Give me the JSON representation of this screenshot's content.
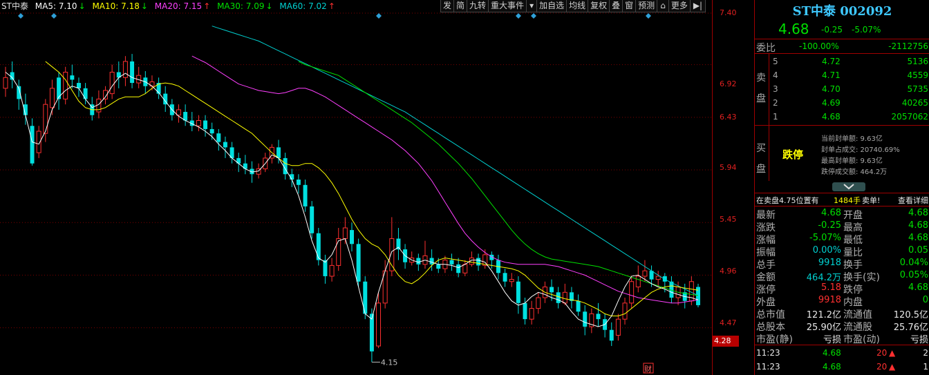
{
  "ma_legend": {
    "stock": "ST中泰",
    "ma5": "MA5: 7.10",
    "ma5_arrow": "↓",
    "ma10": "MA10: 7.18",
    "ma10_arrow": "↓",
    "ma20": "MA20: 7.15",
    "ma20_arrow": "↑",
    "ma30": "MA30: 7.09",
    "ma30_arrow": "↓",
    "ma60": "MA60: 7.02",
    "ma60_arrow": "↑"
  },
  "toolbar": [
    "发",
    "简",
    "九转",
    "重大事件",
    "▾",
    "加自选",
    "均线",
    "复权",
    "叠",
    "窗",
    "预测",
    "⌂",
    "更多",
    "▶|"
  ],
  "colors": {
    "up": "#ff3030",
    "down": "#00e0e0",
    "ma5": "#ffffff",
    "ma10": "#ffff00",
    "ma20": "#ff40ff",
    "ma30": "#00e000",
    "ma60": "#00d0d0",
    "grid": "#800000"
  },
  "price_axis": [
    "7.40",
    "6.92",
    "6.43",
    "5.94",
    "5.45",
    "4.96",
    "4.47"
  ],
  "current_price_tag": "4.28",
  "chart_data": {
    "type": "candlestick",
    "ylim": [
      4.03,
      7.4
    ],
    "low_annotation": "4.15",
    "finance_marker": "财",
    "candles": [
      [
        6.7,
        6.8,
        6.9,
        6.62
      ],
      [
        6.85,
        6.78,
        6.95,
        6.7
      ],
      [
        6.72,
        6.6,
        6.78,
        6.5
      ],
      [
        6.55,
        6.45,
        6.65,
        6.36
      ],
      [
        6.35,
        6.0,
        6.42,
        5.98
      ],
      [
        6.1,
        6.3,
        6.35,
        6.05
      ],
      [
        6.28,
        6.55,
        6.6,
        6.2
      ],
      [
        6.52,
        6.7,
        6.78,
        6.45
      ],
      [
        6.8,
        6.6,
        6.85,
        6.5
      ],
      [
        6.6,
        6.85,
        6.9,
        6.55
      ],
      [
        6.82,
        6.78,
        6.92,
        6.7
      ],
      [
        6.75,
        6.7,
        6.8,
        6.62
      ],
      [
        6.7,
        6.6,
        6.75,
        6.55
      ],
      [
        6.55,
        6.45,
        6.62,
        6.4
      ],
      [
        6.48,
        6.6,
        6.68,
        6.42
      ],
      [
        6.6,
        6.68,
        6.72,
        6.55
      ],
      [
        6.65,
        6.85,
        6.92,
        6.6
      ],
      [
        6.85,
        6.8,
        6.95,
        6.7
      ],
      [
        6.8,
        6.95,
        7.0,
        6.72
      ],
      [
        6.95,
        6.75,
        7.02,
        6.7
      ],
      [
        6.75,
        6.82,
        6.9,
        6.7
      ],
      [
        6.8,
        6.72,
        6.86,
        6.65
      ],
      [
        6.72,
        6.76,
        6.82,
        6.68
      ],
      [
        6.75,
        6.65,
        6.8,
        6.6
      ],
      [
        6.65,
        6.55,
        6.72,
        6.48
      ],
      [
        6.55,
        6.45,
        6.6,
        6.4
      ],
      [
        6.45,
        6.5,
        6.55,
        6.38
      ],
      [
        6.48,
        6.4,
        6.55,
        6.35
      ],
      [
        6.4,
        6.35,
        6.48,
        6.3
      ],
      [
        6.35,
        6.4,
        6.45,
        6.3
      ],
      [
        6.4,
        6.32,
        6.45,
        6.25
      ],
      [
        6.32,
        6.28,
        6.38,
        6.22
      ],
      [
        6.28,
        6.2,
        6.32,
        6.12
      ],
      [
        6.2,
        6.15,
        6.25,
        6.05
      ],
      [
        6.15,
        6.05,
        6.2,
        6.0
      ],
      [
        6.05,
        6.0,
        6.1,
        5.92
      ],
      [
        6.0,
        5.95,
        6.08,
        5.9
      ],
      [
        5.95,
        5.9,
        6.02,
        5.82
      ],
      [
        5.9,
        5.95,
        6.0,
        5.86
      ],
      [
        5.95,
        6.05,
        6.1,
        5.92
      ],
      [
        6.05,
        6.15,
        6.18,
        6.0
      ],
      [
        6.15,
        6.05,
        6.22,
        6.0
      ],
      [
        6.05,
        5.9,
        6.1,
        5.85
      ],
      [
        5.9,
        5.85,
        5.95,
        5.78
      ],
      [
        5.85,
        5.8,
        5.9,
        5.72
      ],
      [
        5.8,
        5.6,
        5.85,
        5.55
      ],
      [
        5.6,
        5.35,
        5.65,
        5.3
      ],
      [
        5.35,
        5.1,
        5.4,
        5.05
      ],
      [
        5.1,
        4.95,
        5.15,
        4.88
      ],
      [
        4.95,
        5.05,
        5.12,
        4.9
      ],
      [
        5.05,
        5.3,
        5.4,
        5.0
      ],
      [
        5.3,
        5.4,
        5.5,
        5.25
      ],
      [
        5.38,
        5.25,
        5.45,
        5.18
      ],
      [
        5.25,
        4.9,
        5.3,
        4.85
      ],
      [
        4.9,
        4.6,
        4.95,
        4.55
      ],
      [
        4.6,
        4.25,
        4.65,
        4.15
      ],
      [
        4.3,
        4.7,
        4.8,
        4.28
      ],
      [
        4.7,
        5.0,
        5.1,
        4.65
      ],
      [
        5.0,
        5.3,
        5.5,
        4.95
      ],
      [
        5.3,
        5.2,
        5.4,
        5.1
      ],
      [
        5.2,
        5.08,
        5.25,
        5.02
      ],
      [
        5.08,
        5.12,
        5.18,
        5.05
      ],
      [
        5.12,
        5.06,
        5.16,
        5.0
      ],
      [
        5.06,
        5.14,
        5.28,
        5.02
      ],
      [
        5.12,
        5.06,
        5.2,
        5.0
      ],
      [
        5.06,
        5.02,
        5.12,
        4.98
      ],
      [
        5.02,
        5.1,
        5.14,
        4.98
      ],
      [
        5.1,
        5.06,
        5.16,
        5.0
      ],
      [
        5.06,
        4.98,
        5.12,
        4.94
      ],
      [
        4.98,
        5.06,
        5.1,
        4.95
      ],
      [
        5.06,
        5.12,
        5.18,
        5.04
      ],
      [
        5.12,
        5.05,
        5.16,
        5.0
      ],
      [
        5.05,
        5.15,
        5.2,
        5.02
      ],
      [
        5.15,
        5.1,
        5.18,
        5.02
      ],
      [
        5.1,
        4.98,
        5.15,
        4.92
      ],
      [
        4.98,
        4.9,
        5.02,
        4.85
      ],
      [
        4.9,
        4.92,
        4.98,
        4.85
      ],
      [
        4.9,
        4.7,
        4.95,
        4.6
      ],
      [
        4.7,
        4.55,
        4.75,
        4.5
      ],
      [
        4.55,
        4.65,
        4.72,
        4.5
      ],
      [
        4.65,
        4.75,
        4.8,
        4.6
      ],
      [
        4.75,
        4.85,
        4.9,
        4.7
      ],
      [
        4.85,
        4.8,
        4.92,
        4.72
      ],
      [
        4.8,
        4.7,
        4.85,
        4.65
      ],
      [
        4.7,
        4.8,
        4.88,
        4.68
      ],
      [
        4.8,
        4.72,
        4.85,
        4.65
      ],
      [
        4.72,
        4.62,
        4.78,
        4.58
      ],
      [
        4.62,
        4.48,
        4.68,
        4.4
      ],
      [
        4.48,
        4.6,
        4.65,
        4.42
      ],
      [
        4.6,
        4.55,
        4.7,
        4.48
      ],
      [
        4.55,
        4.45,
        4.6,
        4.38
      ],
      [
        4.45,
        4.35,
        4.52,
        4.3
      ],
      [
        4.4,
        4.55,
        4.6,
        4.35
      ],
      [
        4.55,
        4.7,
        4.75,
        4.5
      ],
      [
        4.7,
        4.9,
        4.95,
        4.65
      ],
      [
        4.85,
        4.95,
        5.05,
        4.8
      ],
      [
        4.95,
        5.0,
        5.1,
        4.9
      ],
      [
        5.0,
        4.92,
        5.05,
        4.85
      ],
      [
        4.92,
        4.95,
        5.0,
        4.85
      ],
      [
        4.95,
        4.9,
        4.98,
        4.8
      ],
      [
        4.9,
        4.75,
        4.95,
        4.7
      ],
      [
        4.75,
        4.85,
        4.9,
        4.68
      ],
      [
        4.8,
        4.72,
        4.88,
        4.65
      ],
      [
        4.72,
        4.9,
        4.95,
        4.68
      ],
      [
        4.85,
        4.68,
        4.88,
        4.66
      ]
    ],
    "ma5": [
      6.85,
      6.8,
      6.7,
      6.45,
      6.2,
      6.18,
      6.3,
      6.5,
      6.62,
      6.68,
      6.72,
      6.7,
      6.6,
      6.52,
      6.55,
      6.62,
      6.72,
      6.8,
      6.84,
      6.8,
      6.78,
      6.76,
      6.72,
      6.66,
      6.58,
      6.5,
      6.44,
      6.4,
      6.37,
      6.34,
      6.3,
      6.25,
      6.18,
      6.12,
      6.05,
      6.0,
      5.95,
      5.92,
      5.93,
      6.0,
      6.08,
      6.05,
      5.95,
      5.85,
      5.7,
      5.5,
      5.28,
      5.12,
      5.08,
      5.15,
      5.28,
      5.3,
      5.1,
      4.85,
      4.6,
      4.55,
      4.8,
      5.0,
      5.18,
      5.22,
      5.14,
      5.1,
      5.08,
      5.1,
      5.08,
      5.06,
      5.06,
      5.05,
      5.03,
      5.06,
      5.1,
      5.1,
      5.08,
      5.0,
      4.9,
      4.8,
      4.72,
      4.68,
      4.7,
      4.76,
      4.8,
      4.78,
      4.75,
      4.73,
      4.7,
      4.62,
      4.55,
      4.52,
      4.5,
      4.48,
      4.5,
      4.58,
      4.72,
      4.85,
      4.95,
      4.96,
      4.92,
      4.88,
      4.85,
      4.83,
      4.8,
      4.78,
      4.76,
      4.75,
      4.73
    ],
    "ma10": [
      6.95,
      6.9,
      6.85,
      6.78,
      6.68,
      6.58,
      6.52,
      6.5,
      6.5,
      6.52,
      6.56,
      6.6,
      6.62,
      6.62,
      6.62,
      6.65,
      6.7,
      6.74,
      6.75,
      6.74,
      6.72,
      6.68,
      6.64,
      6.6,
      6.56,
      6.52,
      6.48,
      6.44,
      6.4,
      6.36,
      6.32,
      6.28,
      6.22,
      6.16,
      6.1,
      6.05,
      6.0,
      5.98,
      5.98,
      6.0,
      6.0,
      5.96,
      5.9,
      5.82,
      5.72,
      5.6,
      5.48,
      5.38,
      5.3,
      5.25,
      5.22,
      5.15,
      5.05,
      4.96,
      4.9,
      4.88,
      4.92,
      4.98,
      5.05,
      5.1,
      5.12,
      5.11,
      5.1,
      5.09,
      5.08,
      5.07,
      5.06,
      5.05,
      5.04,
      5.03,
      5.02,
      5.0,
      4.96,
      4.9,
      4.84,
      4.8,
      4.78,
      4.76,
      4.74,
      4.73,
      4.72,
      4.7,
      4.67,
      4.64,
      4.6,
      4.58,
      4.58,
      4.6,
      4.65,
      4.7,
      4.75,
      4.8,
      4.83,
      4.85,
      4.86,
      4.85,
      4.84,
      4.83,
      4.82
    ],
    "ma20": [
      7.0,
      6.97,
      6.94,
      6.9,
      6.86,
      6.82,
      6.78,
      6.74,
      6.72,
      6.7,
      6.68,
      6.67,
      6.66,
      6.65,
      6.66,
      6.68,
      6.7,
      6.7,
      6.68,
      6.65,
      6.62,
      6.58,
      6.54,
      6.5,
      6.46,
      6.42,
      6.38,
      6.34,
      6.3,
      6.26,
      6.22,
      6.17,
      6.12,
      6.06,
      6.0,
      5.92,
      5.84,
      5.74,
      5.64,
      5.54,
      5.44,
      5.35,
      5.28,
      5.22,
      5.17,
      5.13,
      5.1,
      5.08,
      5.07,
      5.06,
      5.06,
      5.06,
      5.06,
      5.06,
      5.05,
      5.04,
      5.02,
      5.0,
      4.98,
      4.96,
      4.93,
      4.9,
      4.87,
      4.84,
      4.81,
      4.79,
      4.77,
      4.75,
      4.74,
      4.73,
      4.72,
      4.71,
      4.7,
      4.7,
      4.71,
      4.72,
      4.73
    ],
    "ma30": [
      6.95,
      6.92,
      6.9,
      6.88,
      6.86,
      6.84,
      6.82,
      6.78,
      6.74,
      6.7,
      6.66,
      6.62,
      6.58,
      6.54,
      6.5,
      6.46,
      6.42,
      6.38,
      6.33,
      6.28,
      6.23,
      6.18,
      6.12,
      6.06,
      6.0,
      5.93,
      5.86,
      5.78,
      5.7,
      5.62,
      5.54,
      5.46,
      5.38,
      5.31,
      5.25,
      5.2,
      5.16,
      5.13,
      5.11,
      5.1,
      5.09,
      5.08,
      5.07,
      5.06,
      5.05,
      5.04,
      5.02,
      5.0,
      4.98,
      4.96,
      4.94,
      4.92,
      4.9,
      4.88,
      4.86,
      4.84,
      4.82,
      4.8,
      4.79,
      4.78,
      4.77
    ],
    "ma60": [
      7.28,
      7.26,
      7.24,
      7.22,
      7.2,
      7.18,
      7.16,
      7.14,
      7.11,
      7.08,
      7.05,
      7.02,
      6.99,
      6.96,
      6.93,
      6.9,
      6.87,
      6.84,
      6.81,
      6.78,
      6.75,
      6.72,
      6.69,
      6.66,
      6.63,
      6.6,
      6.57,
      6.54,
      6.51,
      6.48,
      6.44,
      6.4,
      6.36,
      6.32,
      6.28,
      6.24,
      6.2,
      6.16,
      6.12,
      6.08,
      6.04,
      6.0,
      5.96,
      5.92,
      5.88,
      5.84,
      5.8,
      5.76,
      5.72,
      5.68,
      5.64,
      5.6,
      5.56,
      5.52,
      5.48,
      5.44,
      5.4,
      5.36,
      5.32,
      5.28,
      5.24,
      5.2,
      5.16,
      5.12,
      5.08,
      5.04,
      5.0,
      4.96,
      4.92,
      4.89,
      4.86,
      4.83,
      4.8,
      4.77
    ]
  },
  "quote": {
    "title": "ST中泰  002092",
    "price": "4.68",
    "change": "-0.25",
    "change_pct": "-5.07%",
    "weibi_label": "委比",
    "weibi_pct": "-100.00%",
    "weibi_val": "-2112756",
    "sell_side_label_1": "卖",
    "sell_side_label_2": "盘",
    "asks": [
      {
        "lv": "5",
        "price": "4.72",
        "vol": "5136"
      },
      {
        "lv": "4",
        "price": "4.71",
        "vol": "4559"
      },
      {
        "lv": "3",
        "price": "4.70",
        "vol": "5735"
      },
      {
        "lv": "2",
        "price": "4.69",
        "vol": "40265"
      },
      {
        "lv": "1",
        "price": "4.68",
        "vol": "2057062"
      }
    ],
    "buy_side_label_1": "买",
    "buy_side_label_2": "盘",
    "limit_down": "跌停",
    "seal_info": [
      "当前封单额: 9.63亿",
      "封单占成交: 20740.69%",
      "最高封单额: 9.63亿",
      "跌停成交额: 464.2万"
    ],
    "ticker_a": "在卖盘4.75位置有",
    "ticker_b": "1484手",
    "ticker_c": "卖单!",
    "ticker_d": "查看详细",
    "stats": [
      [
        "最新",
        "4.68",
        "green",
        "开盘",
        "4.68",
        "green"
      ],
      [
        "涨跌",
        "-0.25",
        "green",
        "最高",
        "4.68",
        "green"
      ],
      [
        "涨幅",
        "-5.07%",
        "green",
        "最低",
        "4.68",
        "green"
      ],
      [
        "振幅",
        "0.00%",
        "cyan",
        "量比",
        "0.05",
        "green"
      ],
      [
        "总手",
        "9918",
        "cyan",
        "换手",
        "0.04%",
        "green"
      ],
      [
        "金额",
        "464.2万",
        "cyan",
        "换手(实)",
        "0.05%",
        "green"
      ],
      [
        "涨停",
        "5.18",
        "red",
        "跌停",
        "4.68",
        "green"
      ],
      [
        "外盘",
        "9918",
        "red",
        "内盘",
        "0",
        "green"
      ],
      [
        "总市值",
        "121.2亿",
        "white",
        "流通值",
        "120.5亿",
        "white"
      ],
      [
        "总股本",
        "25.90亿",
        "white",
        "流通股",
        "25.76亿",
        "white"
      ],
      [
        "市盈(静)",
        "亏损",
        "white",
        "市盈(动)",
        "亏损",
        "white"
      ]
    ],
    "trades": [
      {
        "time": "11:23",
        "price": "4.68",
        "vol": "20",
        "arrow": "▲",
        "n": "2"
      },
      {
        "time": "11:23",
        "price": "4.68",
        "vol": "20",
        "arrow": "▲",
        "n": "1"
      }
    ]
  }
}
